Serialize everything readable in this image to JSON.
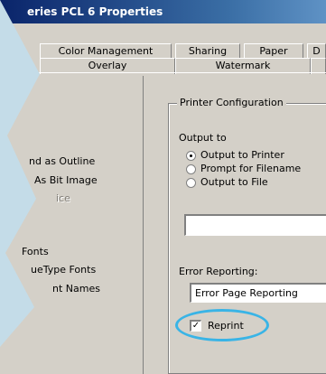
{
  "window": {
    "title": "eries PCL 6 Properties"
  },
  "tabs_row1": [
    "Color Management",
    "Sharing",
    "Paper",
    "D"
  ],
  "tabs_row2": [
    "Overlay",
    "Watermark"
  ],
  "left_panel": {
    "radio_item_1": "nd as Outline",
    "radio_item_2": "As Bit Image",
    "radio_item_3": "ice",
    "fonts_label": "Fonts",
    "fonts_item_1": "ueType Fonts",
    "fonts_item_2": "nt Names"
  },
  "printer_config": {
    "title": "Printer Configuration",
    "output_to_label": "Output to",
    "options": [
      "Output to Printer",
      "Prompt for Filename",
      "Output to File"
    ],
    "selected_option": "Output to Printer",
    "file_path_value": "",
    "error_reporting_label": "Error Reporting:",
    "error_reporting_value": "Error Page Reporting",
    "reprint_label": "Reprint",
    "reprint_checked": true,
    "check_mark": "✓"
  },
  "colors": {
    "annotation_circle": "#39b4e6",
    "title_bar": "#0a246a",
    "dialog_bg": "#d4d0c8"
  }
}
